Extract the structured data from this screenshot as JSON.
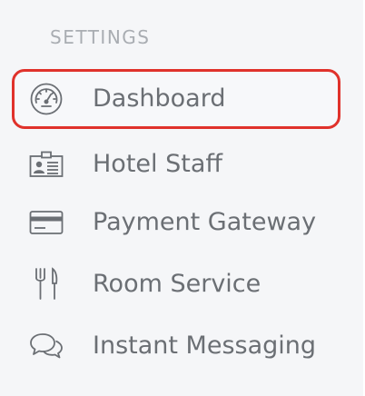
{
  "sidebar": {
    "section_title": "SETTINGS",
    "items": [
      {
        "label": "Dashboard",
        "icon": "dashboard-gauge-icon",
        "active": true
      },
      {
        "label": "Hotel Staff",
        "icon": "id-card-icon",
        "active": false
      },
      {
        "label": "Payment Gateway",
        "icon": "credit-card-icon",
        "active": false
      },
      {
        "label": "Room Service",
        "icon": "fork-knife-icon",
        "active": false
      },
      {
        "label": "Instant Messaging",
        "icon": "chat-bubbles-icon",
        "active": false
      }
    ]
  },
  "colors": {
    "background": "#f5f6f8",
    "active_outline": "#e0322b",
    "text": "#6b6f74",
    "section_title": "#a9adb2"
  }
}
